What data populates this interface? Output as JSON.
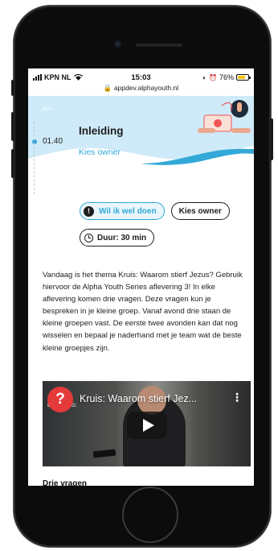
{
  "status_bar": {
    "carrier": "KPN NL",
    "time": "15:03",
    "url": "appdev.alphayouth.nl",
    "battery_percent": "76%",
    "battery_level": 0.76
  },
  "header": {
    "back_icon": "arrow-left-icon",
    "time_marker": "01.40",
    "title": "Inleiding",
    "owner_link": "Kies owner"
  },
  "actions": {
    "wil_ik_label": "Wil ik wel doen",
    "kies_owner_label": "Kies owner",
    "duration_label": "Duur: 30 min"
  },
  "content": {
    "paragraph": "Vandaag is het thema Kruis: Waarom stierf Jezus? Gebruik hiervoor de Alpha Youth Series aflevering 3! In elke aflevering komen drie vragen. Deze vragen kun je bespreken in je kleine groep. Vanaf avond drie staan de kleine groepen vast. De eerste twee avonden kan dat nog wisselen en bepaal je naderhand met je team wat de beste kleine groepjes zijn.",
    "video_title": "Kruis: Waarom stierf Jez...",
    "video_bg_text": "EIGEN WEG:",
    "section_title": "Drie vragen"
  },
  "colors": {
    "accent": "#32a9d8",
    "hero_bg": "#cfeaf8",
    "text": "#1d1d1d"
  }
}
